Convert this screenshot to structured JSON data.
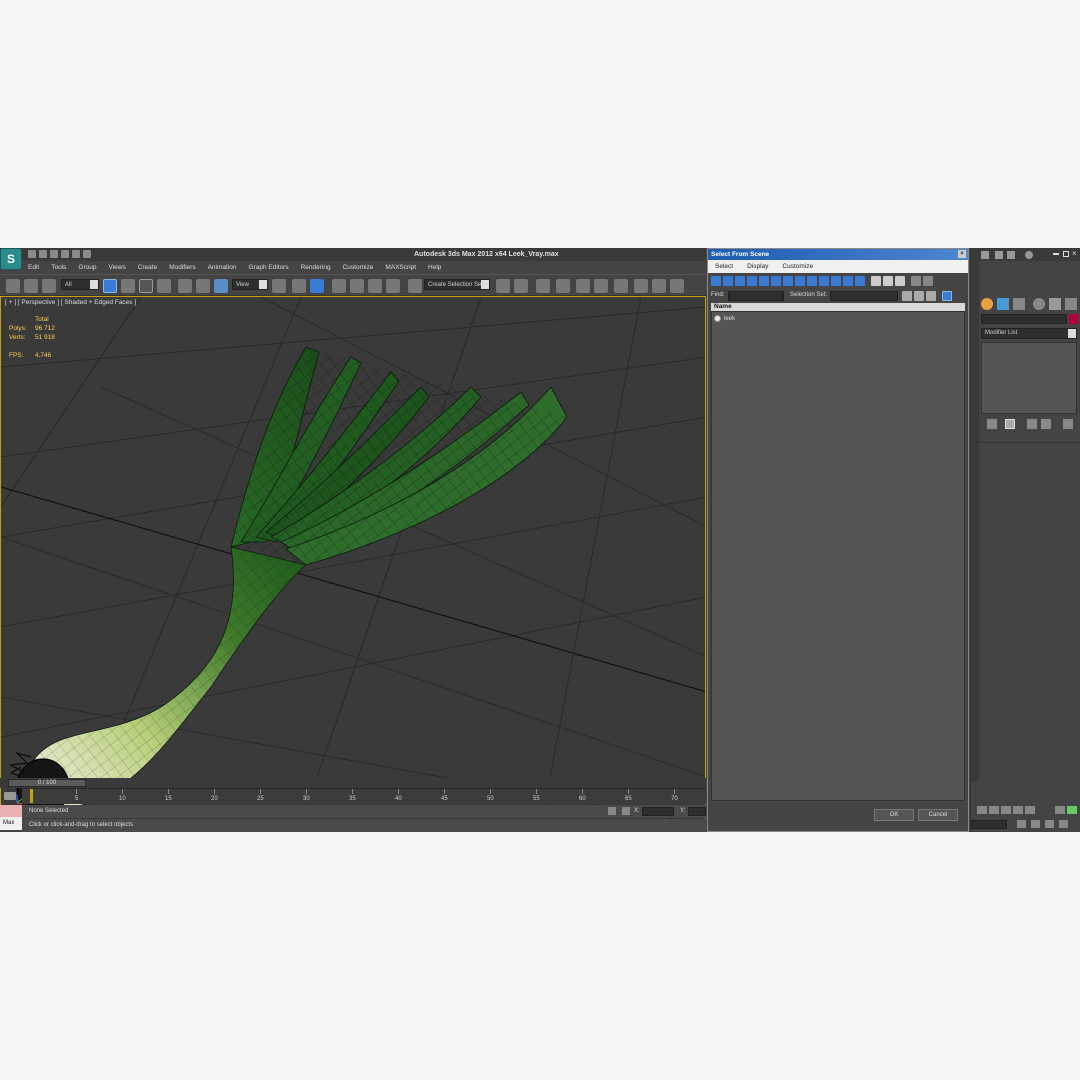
{
  "app": {
    "title": "Autodesk 3ds Max  2012 x64     Leek_Vray.max",
    "logo": "S"
  },
  "menubar": [
    "Edit",
    "Tools",
    "Group",
    "Views",
    "Create",
    "Modifiers",
    "Animation",
    "Graph Editors",
    "Rendering",
    "Customize",
    "MAXScript",
    "Help"
  ],
  "toolbar": {
    "filter_value": "All",
    "ref_coord_value": "View",
    "selection_set_value": "Create Selection Se"
  },
  "viewport": {
    "label": "[ + ] [ Perspective ] [ Shaded + Edged Faces ]",
    "stats": {
      "total_label": "Total",
      "polys_label": "Polys:",
      "polys_value": "96 712",
      "verts_label": "Verts:",
      "verts_value": "51 918",
      "fps_label": "FPS:",
      "fps_value": "4,746"
    }
  },
  "timeline": {
    "frame": "0 / 100",
    "ticks": [
      "5",
      "10",
      "15",
      "20",
      "25",
      "30",
      "35",
      "40",
      "45",
      "50",
      "55",
      "60",
      "65",
      "70"
    ]
  },
  "status": {
    "selection": "None Selected",
    "prompt": "Click or click-and-drag to select objects",
    "x_label": "X:",
    "y_label": "Y:",
    "maxscript_label": "Max"
  },
  "dialog": {
    "title": "Select From Scene",
    "menu": [
      "Select",
      "Display",
      "Customize"
    ],
    "find_label": "Find:",
    "selection_set_label": "Selection Set:",
    "column_name": "Name",
    "items": [
      "leek"
    ],
    "ok_label": "OK",
    "cancel_label": "Cancel"
  },
  "command_panel": {
    "modifier_list": "Modifier List"
  },
  "colors": {
    "dialog_title": "#2a63b8",
    "viewport_border": "#c8a000",
    "object_color": "#b3003a"
  }
}
